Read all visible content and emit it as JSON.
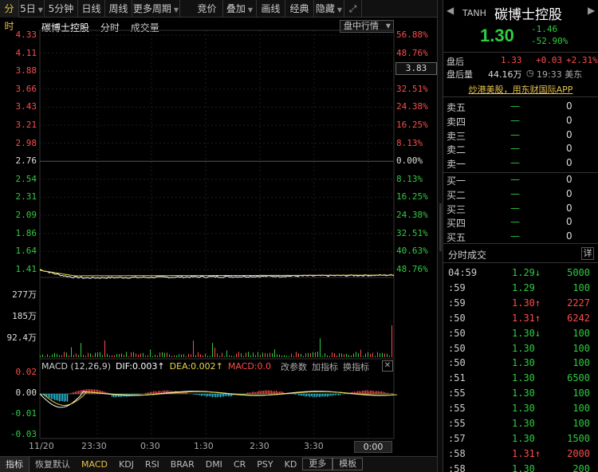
{
  "top_tabs": [
    {
      "label": "分时",
      "dropdown": false,
      "active": true
    },
    {
      "label": "5日",
      "dropdown": true,
      "active": false
    },
    {
      "label": "5分钟",
      "dropdown": false,
      "active": false
    },
    {
      "label": "日线",
      "dropdown": false,
      "active": false
    },
    {
      "label": "周线",
      "dropdown": false,
      "active": false
    },
    {
      "label": "更多周期",
      "dropdown": true,
      "active": false
    },
    {
      "label": "竞价",
      "dropdown": false,
      "active": false
    },
    {
      "label": "叠加",
      "dropdown": true,
      "active": false
    },
    {
      "label": "画线",
      "dropdown": false,
      "active": false
    },
    {
      "label": "经典",
      "dropdown": false,
      "active": false
    },
    {
      "label": "隐藏",
      "dropdown": true,
      "active": false
    }
  ],
  "chart_header": {
    "name": "碳博士控股",
    "mode1": "分时",
    "mode2": "成交量",
    "select_value": "盘中行情"
  },
  "price_axis": {
    "left": [
      "4.33",
      "4.11",
      "3.88",
      "3.66",
      "3.43",
      "3.21",
      "2.98",
      "2.76",
      "2.54",
      "2.31",
      "2.09",
      "1.86",
      "1.64",
      "1.41"
    ],
    "right": [
      "56.88%",
      "48.76%",
      "",
      "32.51%",
      "24.38%",
      "16.25%",
      "8.13%",
      "0.00%",
      "8.13%",
      "16.25%",
      "24.38%",
      "32.51%",
      "40.63%",
      "48.76%"
    ],
    "current_price_box": "3.83"
  },
  "volume_axis": [
    "277万",
    "185万",
    "92.4万"
  ],
  "macd": {
    "title": "MACD (12,26,9)",
    "dif": "DIF:0.003↑",
    "dea": "DEA:0.002↑",
    "macd": "MACD:0.0",
    "btn1": "改参数",
    "btn2": "加指标",
    "btn3": "换指标",
    "close": "✕",
    "axis": [
      "0.02",
      "0.00",
      "-0.01",
      "-0.03"
    ]
  },
  "time_axis": {
    "labels": [
      "11/20",
      "23:30",
      "0:30",
      "1:30",
      "2:30",
      "3:30"
    ],
    "input_value": "0:00"
  },
  "bottom_tabs": [
    {
      "label": "指标",
      "style": "first"
    },
    {
      "label": "恢复默认",
      "style": ""
    },
    {
      "label": "MACD",
      "style": "active"
    },
    {
      "label": "KDJ",
      "style": ""
    },
    {
      "label": "RSI",
      "style": ""
    },
    {
      "label": "BRAR",
      "style": ""
    },
    {
      "label": "DMI",
      "style": ""
    },
    {
      "label": "CR",
      "style": ""
    },
    {
      "label": "PSY",
      "style": ""
    },
    {
      "label": "KD",
      "style": ""
    },
    {
      "label": "更多",
      "style": "boxed"
    },
    {
      "label": "模板",
      "style": "boxed"
    }
  ],
  "quote": {
    "prev_icon": "◀",
    "next_icon": "▶",
    "ticker": "TANH",
    "name": "碳博士控股",
    "price": "1.30",
    "change": "-1.46",
    "change_pct": "-52.90%"
  },
  "after_hours": {
    "label": "盘后",
    "price": "1.33",
    "change": "+0.03",
    "change_pct": "+2.31%",
    "vol_label": "盘后量",
    "vol": "44.16万",
    "time_icon": "◷",
    "time": "19:33 美东"
  },
  "banner": "炒港美股，用东财国际APP",
  "order_book": {
    "asks": [
      {
        "label": "卖五",
        "price": "—",
        "vol": "0"
      },
      {
        "label": "卖四",
        "price": "—",
        "vol": "0"
      },
      {
        "label": "卖三",
        "price": "—",
        "vol": "0"
      },
      {
        "label": "卖二",
        "price": "—",
        "vol": "0"
      },
      {
        "label": "卖一",
        "price": "—",
        "vol": "0"
      }
    ],
    "bids": [
      {
        "label": "买一",
        "price": "—",
        "vol": "0"
      },
      {
        "label": "买二",
        "price": "—",
        "vol": "0"
      },
      {
        "label": "买三",
        "price": "—",
        "vol": "0"
      },
      {
        "label": "买四",
        "price": "—",
        "vol": "0"
      },
      {
        "label": "买五",
        "price": "—",
        "vol": "0"
      }
    ]
  },
  "ticks": {
    "title": "分时成交",
    "detail_btn": "详",
    "rows": [
      {
        "time": "04:59",
        "price": "1.29",
        "arrow": "↓",
        "vol": "5000",
        "color": "green"
      },
      {
        "time": ":59",
        "price": "1.29",
        "arrow": "",
        "vol": "100",
        "color": "green"
      },
      {
        "time": ":59",
        "price": "1.30",
        "arrow": "↑",
        "vol": "2227",
        "color": "red"
      },
      {
        "time": ":50",
        "price": "1.31",
        "arrow": "↑",
        "vol": "6242",
        "color": "red"
      },
      {
        "time": ":50",
        "price": "1.30",
        "arrow": "↓",
        "vol": "100",
        "color": "green"
      },
      {
        "time": ":50",
        "price": "1.30",
        "arrow": "",
        "vol": "100",
        "color": "green"
      },
      {
        "time": ":50",
        "price": "1.30",
        "arrow": "",
        "vol": "100",
        "color": "green"
      },
      {
        "time": ":51",
        "price": "1.30",
        "arrow": "",
        "vol": "6500",
        "color": "green"
      },
      {
        "time": ":55",
        "price": "1.30",
        "arrow": "",
        "vol": "100",
        "color": "green"
      },
      {
        "time": ":55",
        "price": "1.30",
        "arrow": "",
        "vol": "100",
        "color": "green"
      },
      {
        "time": ":55",
        "price": "1.30",
        "arrow": "",
        "vol": "100",
        "color": "green"
      },
      {
        "time": ":57",
        "price": "1.30",
        "arrow": "",
        "vol": "1500",
        "color": "green"
      },
      {
        "time": ":58",
        "price": "1.31",
        "arrow": "↑",
        "vol": "2000",
        "color": "red"
      },
      {
        "time": ":58",
        "price": "1.30",
        "arrow": "",
        "vol": "200",
        "color": "green"
      }
    ]
  },
  "colors": {
    "up": "#ff4b4b",
    "down": "#2ecc40",
    "price_line": "#ffffff",
    "avg_line": "#e8d84a",
    "macd_pos": "#ff4b4b",
    "macd_neg": "#27c5e0",
    "accent": "#e8c14a"
  }
}
